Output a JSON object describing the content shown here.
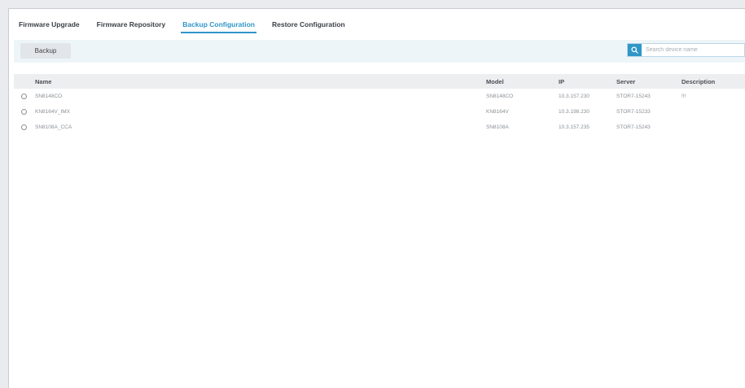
{
  "tabs": [
    {
      "label": "Firmware Upgrade",
      "active": false
    },
    {
      "label": "Firmware Repository",
      "active": false
    },
    {
      "label": "Backup Configuration",
      "active": true
    },
    {
      "label": "Restore Configuration",
      "active": false
    }
  ],
  "toolbar": {
    "backup_label": "Backup",
    "search_placeholder": "Search device name"
  },
  "table": {
    "headers": {
      "name": "Name",
      "model": "Model",
      "ip": "IP",
      "server": "Server",
      "description": "Description"
    },
    "rows": [
      {
        "name": "SN8148CO",
        "model": "SN8148CO",
        "ip": "10.3.157.230",
        "server": "STOR7-15243",
        "description": "!!!"
      },
      {
        "name": "KN8164V_IMX",
        "model": "KN8164V",
        "ip": "10.3.198.230",
        "server": "STOR7-15233",
        "description": ""
      },
      {
        "name": "SN8108A_CCA",
        "model": "SN8108A",
        "ip": "10.3.157.235",
        "server": "STOR7-15243",
        "description": ""
      }
    ]
  },
  "colors": {
    "accent": "#2f96c8",
    "toolbar_bg": "#eef5f9",
    "header_bg": "#eceef0"
  }
}
